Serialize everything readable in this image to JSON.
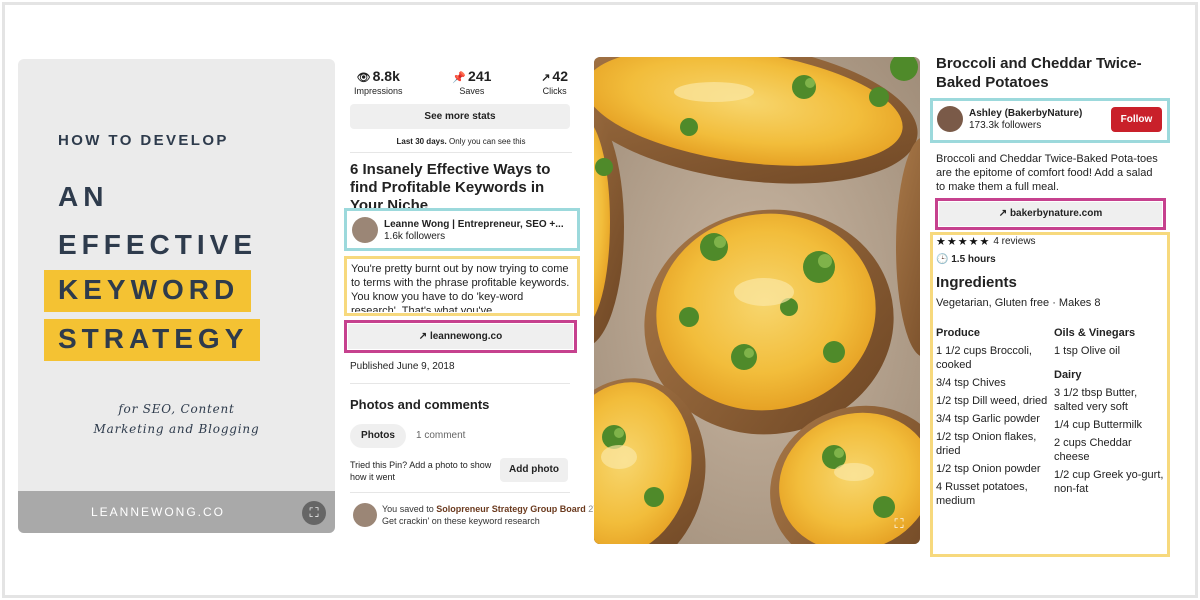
{
  "pin1": {
    "image": {
      "subtitle": "HOW TO DEVELOP",
      "line1": "AN",
      "line2": "EFFECTIVE",
      "line3": "KEYWORD",
      "line4": "STRATEGY",
      "tagline1": "for SEO, Content",
      "tagline2": "Marketing and Blogging",
      "footer_url": "LEANNEWONG.CO",
      "accent_color": "#f4c233"
    },
    "stats": [
      {
        "icon": "eye-icon",
        "value": "8.8k",
        "label": "Impressions"
      },
      {
        "icon": "pin-icon",
        "value": "241",
        "label": "Saves"
      },
      {
        "icon": "arrow-icon",
        "value": "42",
        "label": "Clicks"
      }
    ],
    "see_stats_label": "See more stats",
    "last30_bold": "Last 30 days.",
    "last30_rest": " Only you can see this",
    "title": "6 Insanely Effective Ways to find Profitable Keywords in Your Niche",
    "creator": {
      "name": "Leanne Wong | Entrepreneur, SEO +...",
      "followers": "1.6k followers"
    },
    "description": "You're pretty burnt out by now trying to come to terms with the phrase profitable keywords. You know you have to do 'key-word research'. That's what you've",
    "link": "leannewong.co",
    "published": "Published June 9, 2018",
    "photos_heading": "Photos and comments",
    "photos_chip": "Photos",
    "comment_tab": "1 comment",
    "tried_text": "Tried this Pin? Add a photo to show how it went",
    "add_photo": "Add photo",
    "saved": {
      "prefix": "You saved to ",
      "board": "Solopreneur Strategy Group Board",
      "time": " 27m",
      "note": "Get crackin' on these keyword research"
    }
  },
  "pin2": {
    "title": "Broccoli and Cheddar Twice-Baked Potatoes",
    "creator": {
      "name": "Ashley (BakerbyNature)",
      "followers": "173.3k followers"
    },
    "follow_label": "Follow",
    "description": "Broccoli and Cheddar Twice-Baked Pota-toes are the epitome of comfort food! Add a salad to make them a full meal.",
    "link": "bakerbynature.com",
    "stars": "★★★★★",
    "reviews": "4 reviews",
    "time": "1.5 hours",
    "ingredients_heading": "Ingredients",
    "diet": "Vegetarian, Gluten free · Makes 8",
    "produce": {
      "heading": "Produce",
      "items": [
        "1 1/2 cups Broccoli, cooked",
        "3/4 tsp Chives",
        "1/2 tsp Dill weed, dried",
        "3/4 tsp Garlic powder",
        "1/2 tsp Onion flakes, dried",
        "1/2 tsp Onion powder",
        "4 Russet potatoes, medium"
      ]
    },
    "oils": {
      "heading": "Oils & Vinegars",
      "items": [
        "1 tsp Olive oil"
      ]
    },
    "dairy": {
      "heading": "Dairy",
      "items": [
        "3 1/2 tbsp Butter, salted very soft",
        "1/4 cup Buttermilk",
        "2 cups Cheddar cheese",
        "1/2 cup Greek yo-gurt, non-fat"
      ]
    }
  },
  "colors": {
    "teal_box": "#9cd9dc",
    "yellow_box": "#f7d97d",
    "pink_box": "#c6418e",
    "follow_red": "#c9202a"
  }
}
